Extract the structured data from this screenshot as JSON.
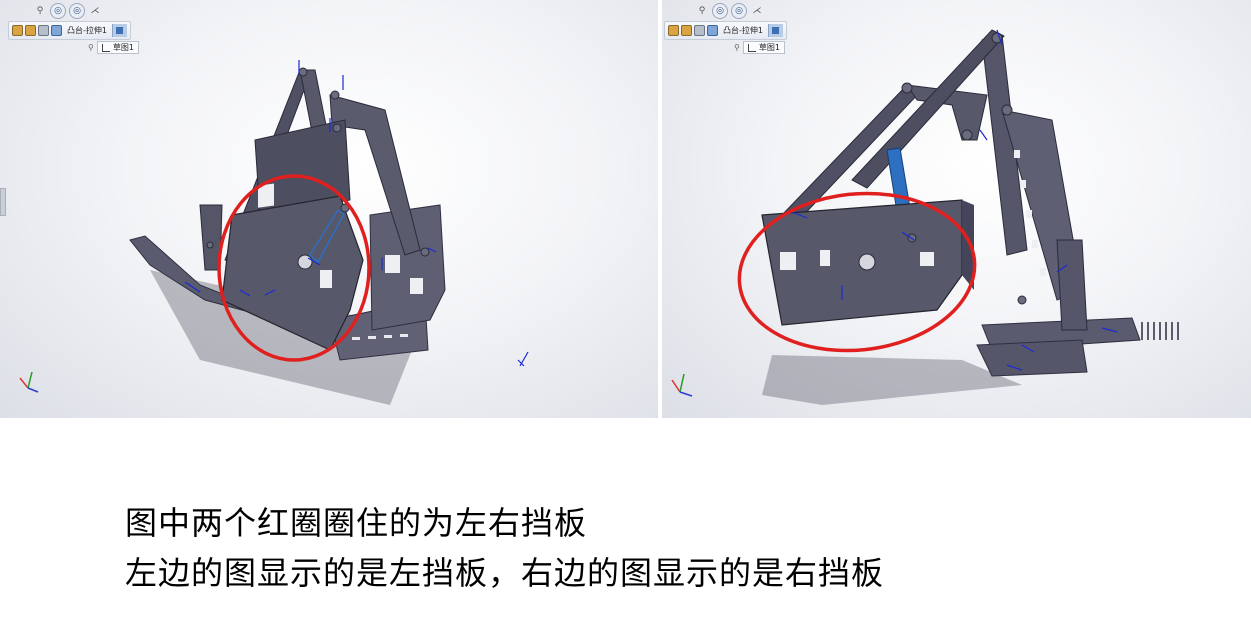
{
  "left_view": {
    "breadcrumb": {
      "feature_label": "凸台-拉伸1"
    },
    "sketch_label": "草图1"
  },
  "right_view": {
    "breadcrumb": {
      "feature_label": "凸台-拉伸1"
    },
    "sketch_label": "草图1"
  },
  "caption": {
    "line1": "图中两个红圈圈住的为左右挡板",
    "line2": "左边的图显示的是左挡板，右边的图显示的是右挡板"
  },
  "colors": {
    "highlight_circle": "#e0201e",
    "model_body": "#55566a",
    "constraint_arrows": "#1a2bd6",
    "selected_part": "#2d6fc0"
  },
  "icons": [
    "pin-icon",
    "view-orientation-icon",
    "display-style-icon",
    "sketch-icon",
    "part-icon",
    "feature-icon",
    "axis-triad-icon"
  ]
}
